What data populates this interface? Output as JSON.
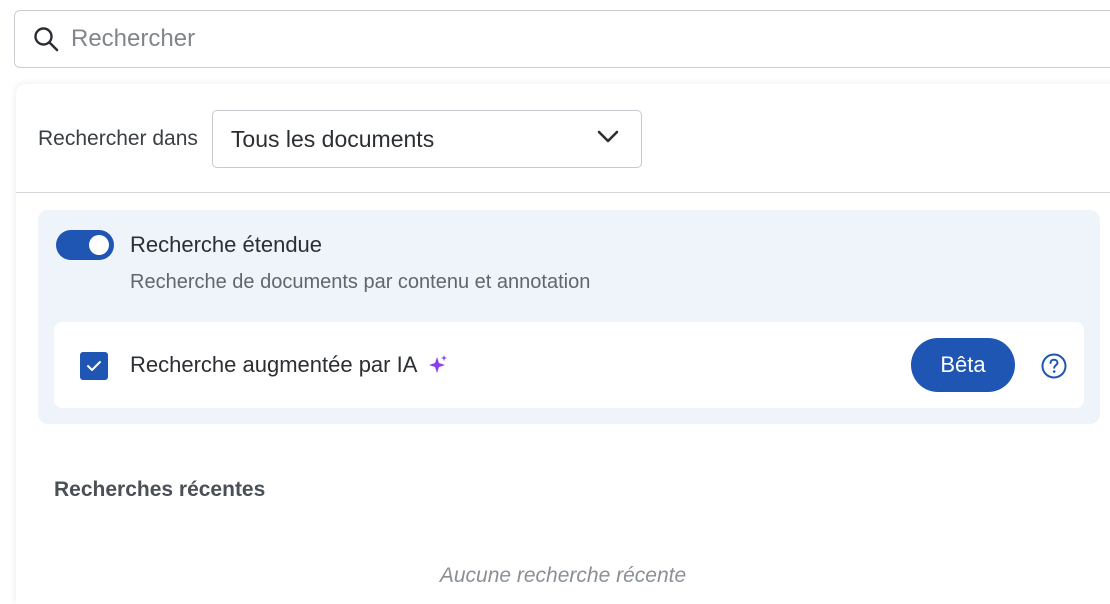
{
  "search": {
    "placeholder": "Rechercher",
    "value": ""
  },
  "scope": {
    "label": "Rechercher dans",
    "selected": "Tous les documents"
  },
  "extended_search": {
    "title": "Recherche étendue",
    "description": "Recherche de documents par contenu et annotation",
    "enabled": true
  },
  "ai_search": {
    "label": "Recherche augmentée par IA",
    "checked": true,
    "badge_label": "Bêta"
  },
  "recent": {
    "title": "Recherches récentes",
    "empty_text": "Aucune recherche récente"
  },
  "icons": {
    "search": "search-icon",
    "dropdown": "chevron-down-icon",
    "sparkle": "sparkle-icon",
    "help": "help-icon",
    "check": "check-icon"
  },
  "colors": {
    "accent": "#1f56b4",
    "options_bg": "#eff4fb",
    "sparkle": "#8a3ff0"
  }
}
